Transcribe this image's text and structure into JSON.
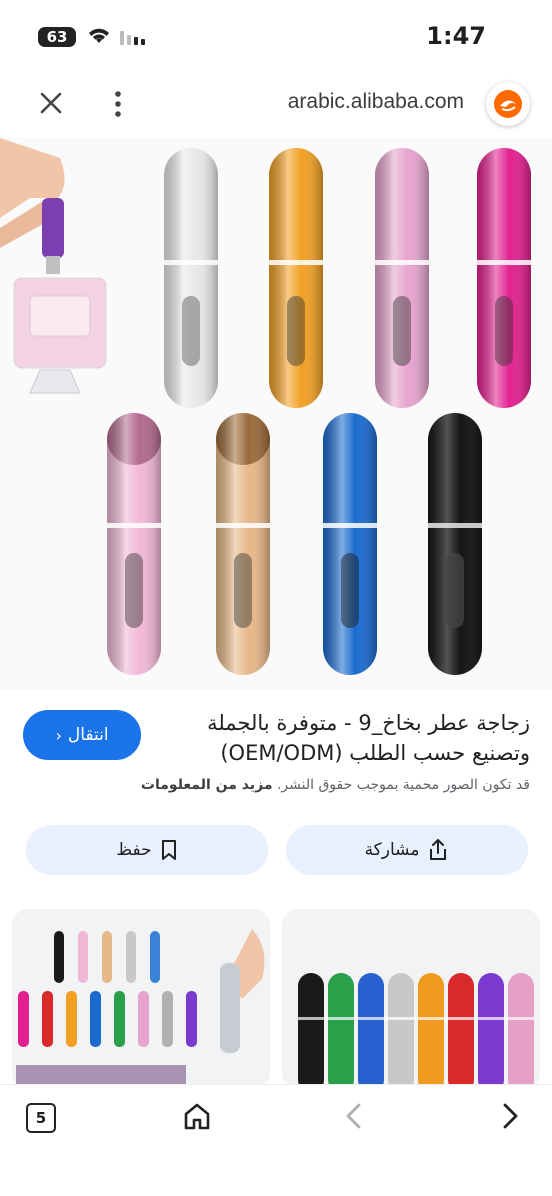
{
  "status": {
    "time": "1:47",
    "battery": "63"
  },
  "browser": {
    "url": "arabic.alibaba.com"
  },
  "result": {
    "title": "زجاجة عطر بخاخ_9 - متوفرة بالجملة وتصنيع حسب الطلب (OEM/ODM)",
    "go_label": "انتقال",
    "notice": "قد تكون الصور محمية بموجب حقوق النشر.",
    "more_info": "مزيد من المعلومات",
    "share_label": "مشاركة",
    "save_label": "حفظ"
  },
  "nav": {
    "tab_count": "5"
  },
  "colors": {
    "accent": "#1a73e8",
    "pill": "#e8f0fe",
    "bottles_top": [
      "#e6e8ea",
      "#f2a024",
      "#e7a4cf",
      "#e2208f"
    ],
    "bottles_bottom": [
      "#f1b8d6",
      "#e7b888",
      "#1a6ad0",
      "#151515"
    ],
    "thumb_right": [
      "#1a1a1a",
      "#2ba04a",
      "#2a5fd0",
      "#c8c8c8",
      "#f09a20",
      "#d82a2a",
      "#7a3ad0",
      "#e6a0c8"
    ]
  }
}
